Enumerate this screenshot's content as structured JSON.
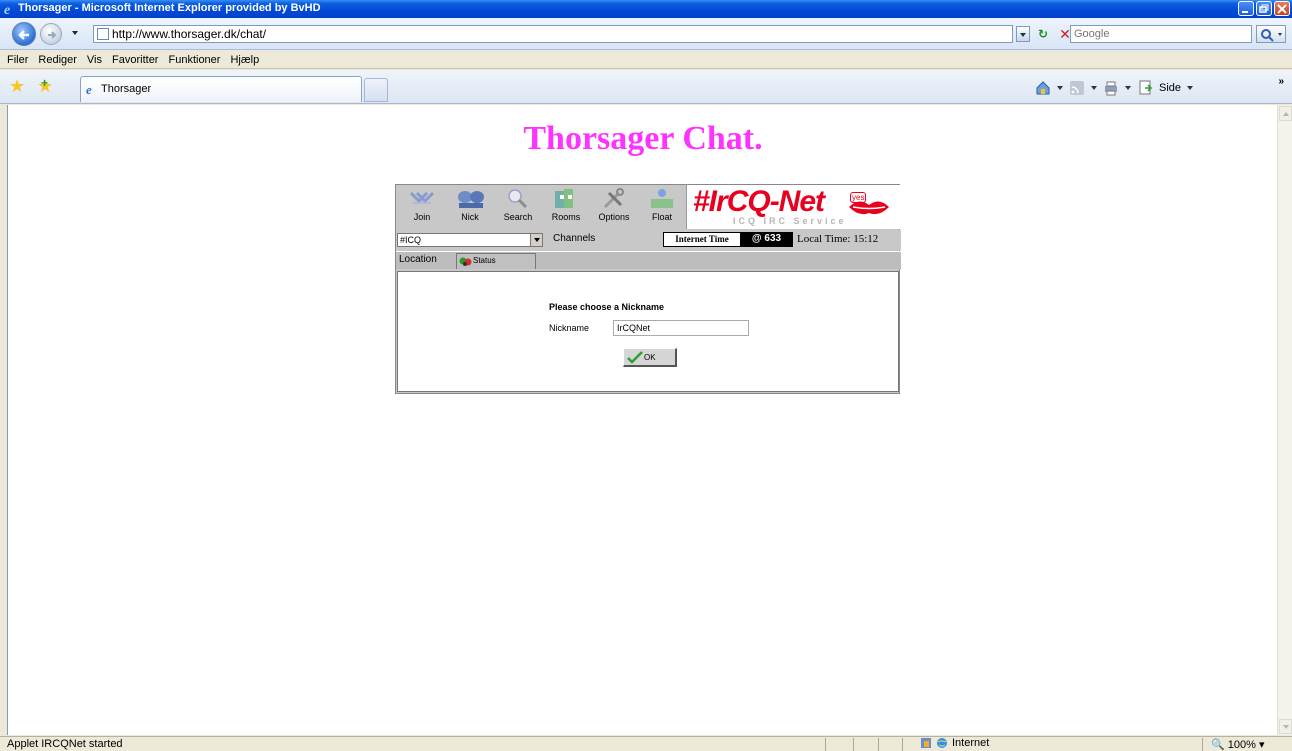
{
  "window": {
    "title": "Thorsager - Microsoft Internet Explorer provided by BvHD"
  },
  "address": {
    "url": "http://www.thorsager.dk/chat/",
    "search_placeholder": "Google"
  },
  "menu": {
    "items": [
      "Filer",
      "Rediger",
      "Vis",
      "Favoritter",
      "Funktioner",
      "Hjælp"
    ]
  },
  "tab": {
    "label": "Thorsager"
  },
  "commandbar": {
    "page_label": "Side"
  },
  "page": {
    "title": "Thorsager Chat."
  },
  "applet": {
    "toolbar": [
      "Join",
      "Nick",
      "Search",
      "Rooms",
      "Options",
      "Float"
    ],
    "logo": {
      "main": "#IrCQ-Net",
      "sub": "ICQ IRC Service",
      "badge": "yes"
    },
    "channel": {
      "selected": "#ICQ",
      "label": "Channels"
    },
    "internet_time_label": "Internet Time",
    "internet_time_value": "@ 633",
    "local_time": "Local Time: 15:12",
    "location_label": "Location",
    "status_tab": "Status",
    "dialog": {
      "title": "Please choose a Nickname",
      "nick_label": "Nickname",
      "nick_value": "IrCQNet",
      "ok_label": "OK"
    }
  },
  "statusbar": {
    "text": "Applet IRCQNet started",
    "zone": "Internet",
    "zoom": "100%"
  },
  "colors": {
    "page_title": "#ff33ff",
    "logo_red": "#e8001e",
    "titlebar_blue": "#0349d6"
  }
}
